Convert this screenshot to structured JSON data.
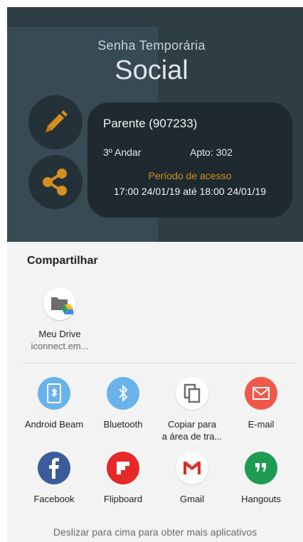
{
  "header": {
    "subtitle": "Senha Temporária",
    "title": "Social"
  },
  "card": {
    "name": "Parente (907233)",
    "floor": "3º Andar",
    "apartment": "Apto: 302",
    "period_label": "Período de acesso",
    "period": "17:00 24/01/19 até 18:00 24/01/19"
  },
  "icons": {
    "edit": "pencil-icon",
    "share": "share-icon"
  },
  "colors": {
    "accent": "#d48f1f",
    "dark_bg": "#2f3d45",
    "card_bg": "#1e2a30"
  },
  "share_sheet": {
    "title": "Compartilhar",
    "direct": {
      "label": "Meu Drive",
      "sublabel": "iconnect.em..."
    },
    "apps": [
      {
        "label": "Android Beam",
        "color": "#69b3ea"
      },
      {
        "label": "Bluetooth",
        "color": "#69b3ea"
      },
      {
        "label": "Copiar para",
        "label2": "a área de tra...",
        "color": "#ffffff"
      },
      {
        "label": "E-mail",
        "color": "#f0584a"
      },
      {
        "label": "Facebook",
        "color": "#3b5b9a"
      },
      {
        "label": "Flipboard",
        "color": "#e52828"
      },
      {
        "label": "Gmail",
        "color": "#ffffff"
      },
      {
        "label": "Hangouts",
        "color": "#1f9a52"
      }
    ],
    "hint": "Deslizar para cima para obter mais aplicativos"
  }
}
